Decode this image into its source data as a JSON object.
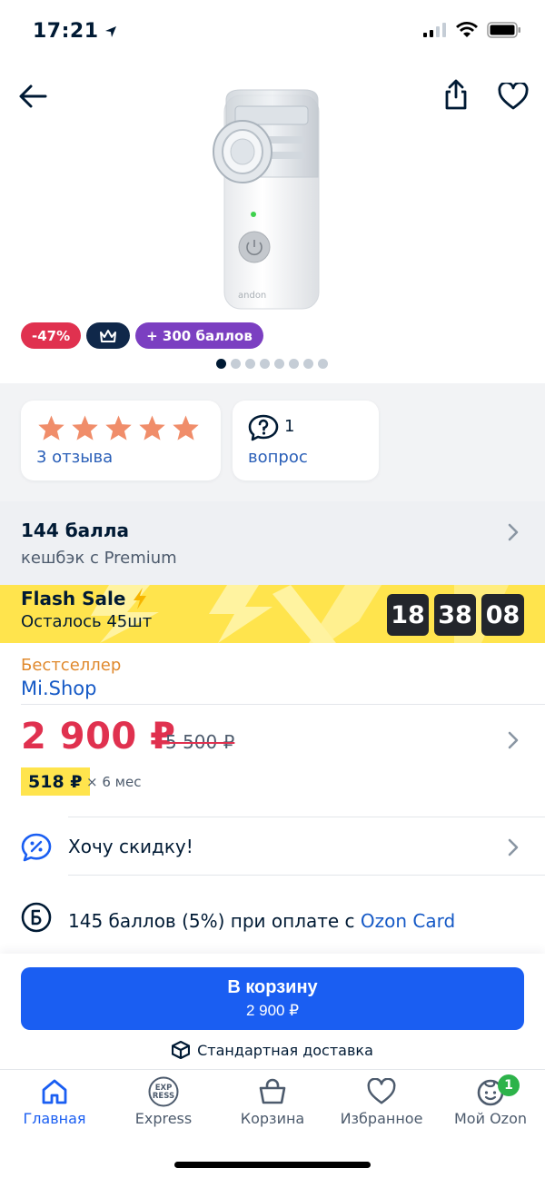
{
  "status_bar": {
    "time": "17:21"
  },
  "header": {
    "back_icon": "arrow-left-icon",
    "share_icon": "share-icon",
    "favorite_icon": "heart-icon"
  },
  "product": {
    "image_brand_text": "andon"
  },
  "badges": {
    "discount": "-47%",
    "crown_icon": "crown-icon",
    "points": "+ 300 баллов"
  },
  "gallery": {
    "dot_count": 8,
    "active_index": 0
  },
  "reviews": {
    "stars": 5,
    "reviews_label": "3 отзыва",
    "questions_count": "1",
    "questions_label": "вопрос"
  },
  "cashback": {
    "title": "144 балла",
    "subtitle": "кешбэк с Premium"
  },
  "flash_sale": {
    "title": "Flash Sale",
    "remaining": "Осталось 45шт",
    "timer": {
      "hours": "18",
      "minutes": "38",
      "seconds": "08"
    }
  },
  "seller": {
    "label": "Бестселлер",
    "name": "Mi.Shop"
  },
  "price": {
    "current": "2 900 ₽",
    "old": "5 500 ₽",
    "installment": "518 ₽",
    "installment_term": "× 6 мес"
  },
  "discount_row": {
    "label": "Хочу скидку!"
  },
  "points_row": {
    "text": "145 баллов (5%) при оплате с ",
    "link": "Ozon Card"
  },
  "cart": {
    "title": "В корзину",
    "price": "2 900 ₽",
    "delivery": "Стандартная доставка"
  },
  "tabbar": {
    "tabs": [
      {
        "label": "Главная",
        "icon": "home-icon"
      },
      {
        "label": "Express",
        "icon": "express-icon",
        "icon_text": [
          "EXP",
          "RESS"
        ]
      },
      {
        "label": "Корзина",
        "icon": "cart-icon"
      },
      {
        "label": "Избранное",
        "icon": "heart-icon"
      },
      {
        "label": "Мой Ozon",
        "icon": "profile-icon",
        "badge": "1"
      }
    ]
  },
  "colors": {
    "accent": "#1a5ef2",
    "price_red": "#e0314f",
    "flash_yellow": "#ffe44d",
    "points_purple": "#7b3fc1"
  }
}
